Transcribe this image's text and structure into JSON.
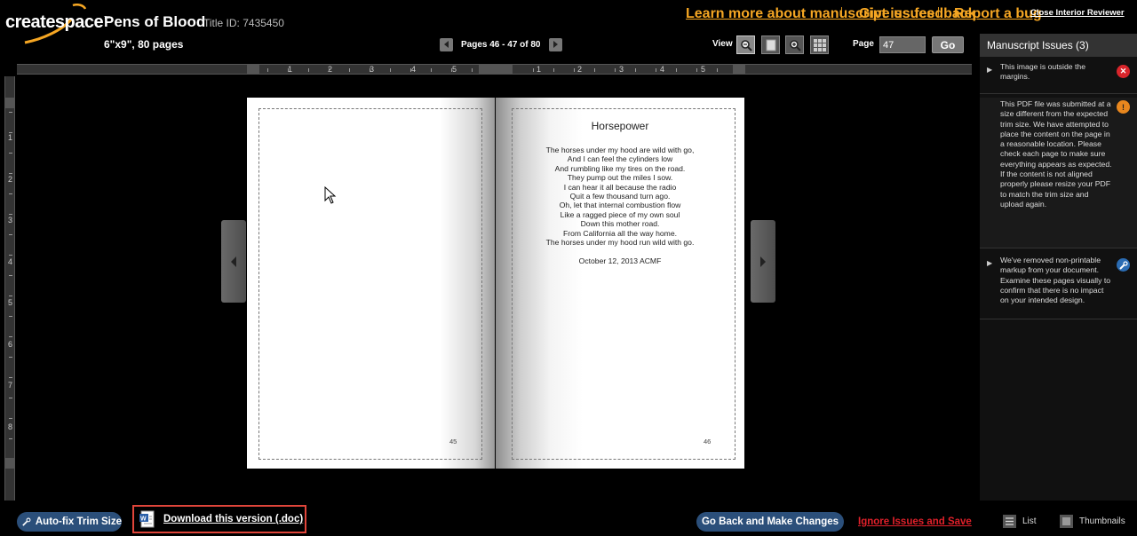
{
  "header": {
    "logo_text": "createspace",
    "logo_tm": "™",
    "book_title": "Pens of Blood",
    "title_id": "Title ID: 7435450",
    "trim_info": "6\"x9\", 80 pages"
  },
  "links": {
    "learn_more": "Learn more about manuscript issues",
    "feedback": "Give us feedback",
    "report_bug": "Report a bug",
    "separator": "|",
    "close_reviewer": "Close Interior Reviewer"
  },
  "pager": {
    "label": "Pages 46 - 47 of 80"
  },
  "view": {
    "label": "View",
    "modes": [
      "zoom-out-icon",
      "single-page-icon",
      "zoom-in-icon",
      "grid-view-icon"
    ]
  },
  "page_nav": {
    "label": "Page",
    "value": "47",
    "go_label": "Go"
  },
  "ruler": {
    "h_numbers": [
      "1",
      "2",
      "3",
      "4",
      "5",
      "1",
      "2",
      "3",
      "4",
      "5"
    ],
    "v_numbers": [
      "1",
      "2",
      "3",
      "4",
      "5",
      "6",
      "7",
      "8"
    ]
  },
  "book": {
    "left_page_number": "45",
    "right_page_number": "46",
    "poem_title": "Horsepower",
    "poem_lines": [
      "The horses under my hood are wild with go,",
      "And I can feel the cylinders low",
      "And rumbling like my tires on the road.",
      "They pump out the miles I sow.",
      "I can hear it all because the radio",
      "Quit a few thousand turn ago.",
      "Oh, let that internal combustion flow",
      "Like a ragged piece of my own soul",
      "Down this mother road.",
      "From California all the way home.",
      "The horses under my hood run wild with go."
    ],
    "poem_date": "October 12, 2013 ACMF"
  },
  "panel": {
    "title": "Manuscript Issues (3)",
    "issues": [
      {
        "text": "This image is outside the margins.",
        "icon": "error-icon",
        "color": "#d9252b"
      },
      {
        "text": "This PDF file was submitted at a size different from the expected trim size. We have attempted to place the content on the page in a reasonable location. Please check each page to make sure everything appears as expected. If the content is not aligned properly please resize your PDF to match the trim size and upload again.",
        "icon": "warning-icon",
        "color": "#e8871e"
      },
      {
        "text": "We've removed non-printable markup from your document. Examine these pages visually to confirm that there is no impact on your intended design.",
        "icon": "wrench-icon",
        "color": "#2b6cb3"
      }
    ]
  },
  "footer": {
    "autofix_label": "Auto-fix Trim Size",
    "download_label": "Download this version (.doc)",
    "go_back_label": "Go Back and Make Changes",
    "ignore_label": "Ignore Issues and Save",
    "list_label": "List",
    "thumbnails_label": "Thumbnails"
  },
  "colors": {
    "accent_link": "#f5a623",
    "button_blue": "#2b4f7a",
    "danger": "#e0202a"
  }
}
